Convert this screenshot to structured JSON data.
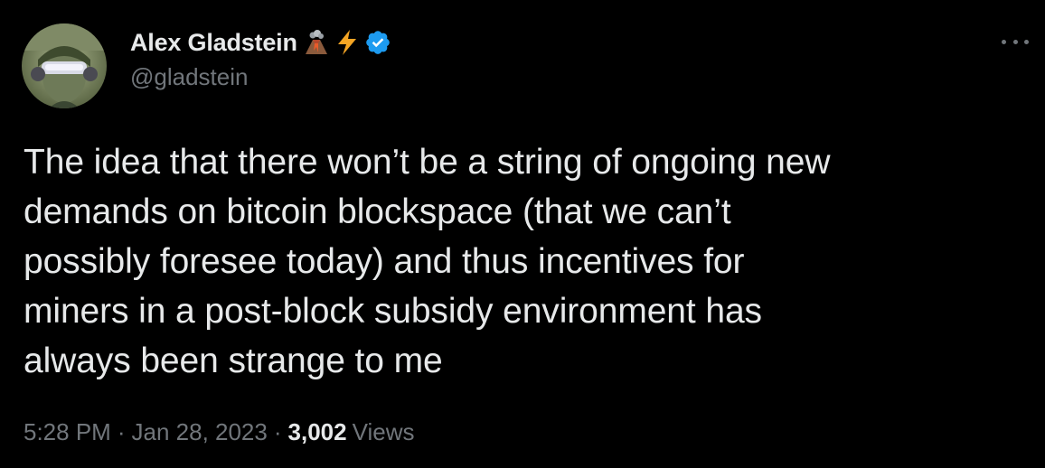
{
  "author": {
    "display_name": "Alex Gladstein",
    "handle": "@gladstein",
    "name_icons": [
      "volcano-emoji",
      "lightning-emoji",
      "verified-badge-icon"
    ]
  },
  "tweet": {
    "text": "The idea that there won’t be a string of ongoing new\ndemands on bitcoin blockspace (that we can’t\npossibly foresee today) and thus incentives for\nminers in a post-block subsidy environment has\nalways been strange to me"
  },
  "meta": {
    "time": "5:28 PM",
    "separator": "·",
    "date": "Jan 28, 2023",
    "views_count": "3,002",
    "views_label": "Views"
  },
  "colors": {
    "background": "#000000",
    "primary_text": "#e7e9ea",
    "secondary_text": "#71767b",
    "verified_blue": "#1d9bf0",
    "lightning": "#f4a524"
  }
}
